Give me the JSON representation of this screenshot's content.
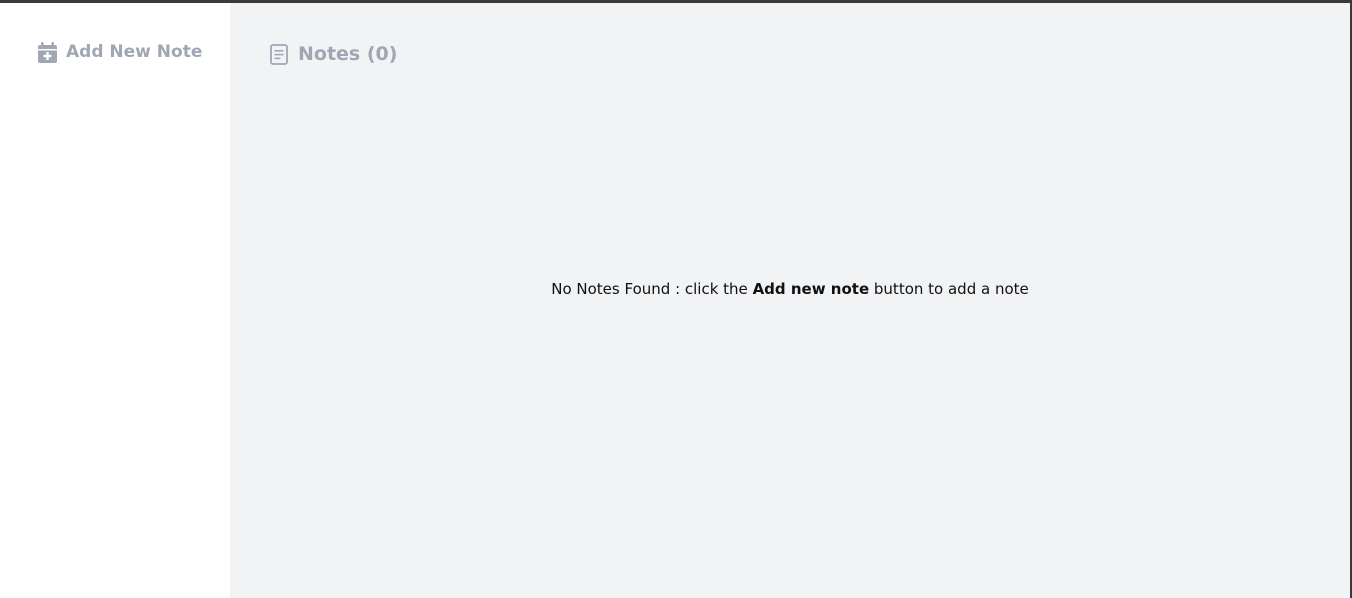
{
  "sidebar": {
    "add_note_label": "Add New Note",
    "add_note_icon": "calendar-plus-icon"
  },
  "main": {
    "heading_label": "Notes",
    "heading_count": "(0)",
    "heading_icon": "note-icon",
    "empty_message": {
      "prefix": "No Notes Found : click the ",
      "highlight": "Add new note",
      "suffix": " button to add a note"
    }
  },
  "colors": {
    "muted_text": "#a0a6b3",
    "main_background": "#f2f3f5",
    "sidebar_background": "#ffffff",
    "border": "#3a3a3a"
  }
}
